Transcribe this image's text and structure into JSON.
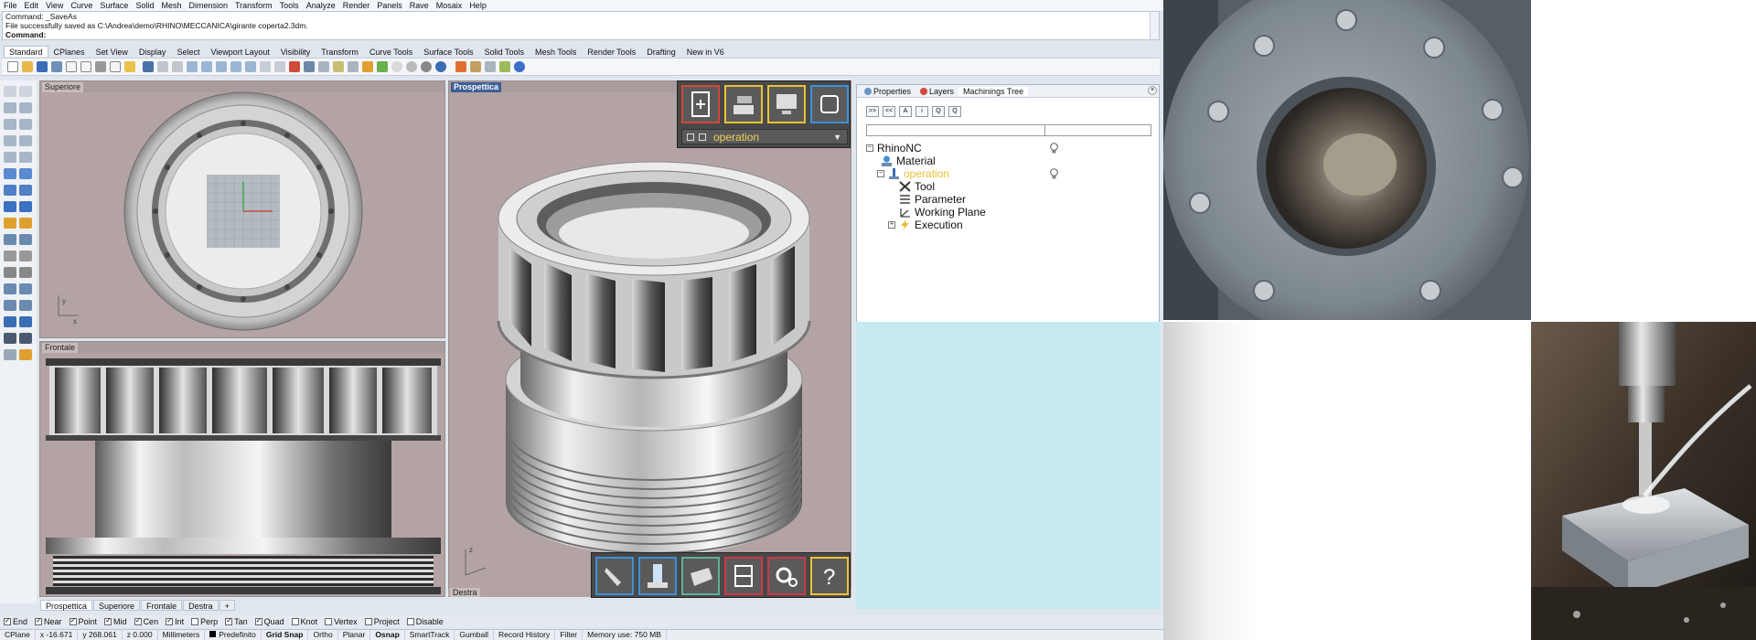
{
  "menu": [
    "File",
    "Edit",
    "View",
    "Curve",
    "Surface",
    "Solid",
    "Mesh",
    "Dimension",
    "Transform",
    "Tools",
    "Analyze",
    "Render",
    "Panels",
    "Rave",
    "Mosaix",
    "Help"
  ],
  "command_history": {
    "line1": "Command: _SaveAs",
    "line2": "File successfully saved as C:\\Andrea\\demo\\RHINO\\MECCANICA\\girante coperta2.3dm.",
    "prompt": "Command:"
  },
  "toolbar_tabs": [
    "Standard",
    "CPlanes",
    "Set View",
    "Display",
    "Select",
    "Viewport Layout",
    "Visibility",
    "Transform",
    "Curve Tools",
    "Surface Tools",
    "Solid Tools",
    "Mesh Tools",
    "Render Tools",
    "Drafting",
    "New in V6"
  ],
  "active_toolbar_tab": "Standard",
  "viewports": {
    "top": "Superiore",
    "front": "Frontale",
    "perspective": "Prospettica",
    "right": "Destra"
  },
  "viewport_tabs": [
    "Prospettica",
    "Superiore",
    "Frontale",
    "Destra"
  ],
  "axes": {
    "x": "x",
    "y": "y",
    "z": "z"
  },
  "panel": {
    "tabs": [
      "Properties",
      "Layers",
      "Machinings Tree"
    ],
    "buttons": [
      ">>",
      "<<",
      "A",
      "i",
      "Q",
      "Q"
    ],
    "tree": {
      "root": "RhinoNC",
      "material": "Material",
      "operation": "operation",
      "tool": "Tool",
      "parameter": "Parameter",
      "working_plane": "Working Plane",
      "execution": "Execution"
    }
  },
  "operation_selector": "operation",
  "osnaps": [
    {
      "label": "End",
      "on": true
    },
    {
      "label": "Near",
      "on": true
    },
    {
      "label": "Point",
      "on": true
    },
    {
      "label": "Mid",
      "on": true
    },
    {
      "label": "Cen",
      "on": true
    },
    {
      "label": "Int",
      "on": true
    },
    {
      "label": "Perp",
      "on": false
    },
    {
      "label": "Tan",
      "on": true
    },
    {
      "label": "Quad",
      "on": true
    },
    {
      "label": "Knot",
      "on": false
    },
    {
      "label": "Vertex",
      "on": false
    },
    {
      "label": "Project",
      "on": false
    },
    {
      "label": "Disable",
      "on": false
    }
  ],
  "status": {
    "cplane": "CPlane",
    "x": "x -16.671",
    "y": "y 268.061",
    "z": "z 0.000",
    "units": "Millimeters",
    "layer": "Predefinito",
    "grid_snap": "Grid Snap",
    "ortho": "Ortho",
    "planar": "Planar",
    "osnap": "Osnap",
    "smarttrack": "SmartTrack",
    "gumball": "Gumball",
    "record_history": "Record History",
    "filter": "Filter",
    "memory": "Memory use: 750 MB"
  },
  "colors": {
    "viewport_bg": "#b3a3a4",
    "active_label": "#3d5f97",
    "operation_text": "#f0d05a",
    "cyan_panel": "#c5eaf2"
  },
  "icons": {
    "palette_top": [
      "new-machining-icon",
      "material-stock-icon",
      "simulation-monitor-icon",
      "working-plane-icon"
    ],
    "palette_bottom": [
      "tool-icon",
      "machine-icon",
      "stock-block-icon",
      "cabinet-icon",
      "settings-gears-icon",
      "help-icon"
    ]
  }
}
